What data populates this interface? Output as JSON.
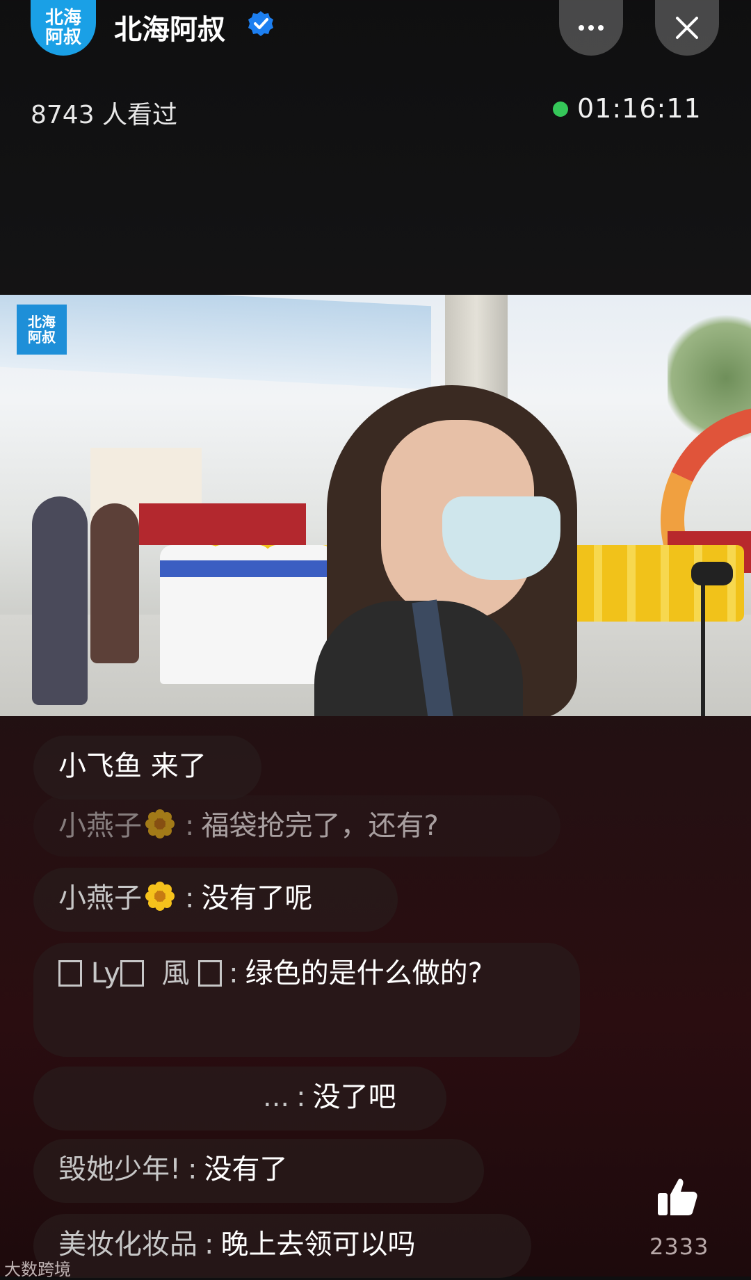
{
  "header": {
    "avatar_text": "北海\n阿叔",
    "channel_name": "北海阿叔",
    "verified_icon": "verified-badge-icon",
    "viewers": "8743 人看过",
    "live_status_color": "#35c759",
    "timer": "01:16:11"
  },
  "video": {
    "logo_text": "北海\n阿叔"
  },
  "comments": [
    {
      "text": "小飞鱼 来了"
    },
    {
      "user": "小燕子",
      "has_flower": true,
      "sep": ":",
      "message": "福袋抢完了，还有?"
    },
    {
      "user": "小燕子",
      "has_flower": true,
      "sep": ":",
      "message": "没有了呢"
    },
    {
      "user_prefix": "Ly",
      "user_mid": "風",
      "sep": ":",
      "message": "绿色的是什么做的?"
    },
    {
      "user": "...",
      "sep": ":",
      "message": "没了吧"
    },
    {
      "user": "毁她少年!",
      "sep": ":",
      "message": "没有了"
    },
    {
      "user": "美妆化妆品",
      "sep": ":",
      "message": "晚上去领可以吗"
    }
  ],
  "like": {
    "icon": "thumbs-up-icon",
    "count": "2333"
  },
  "watermark": "大数跨境"
}
